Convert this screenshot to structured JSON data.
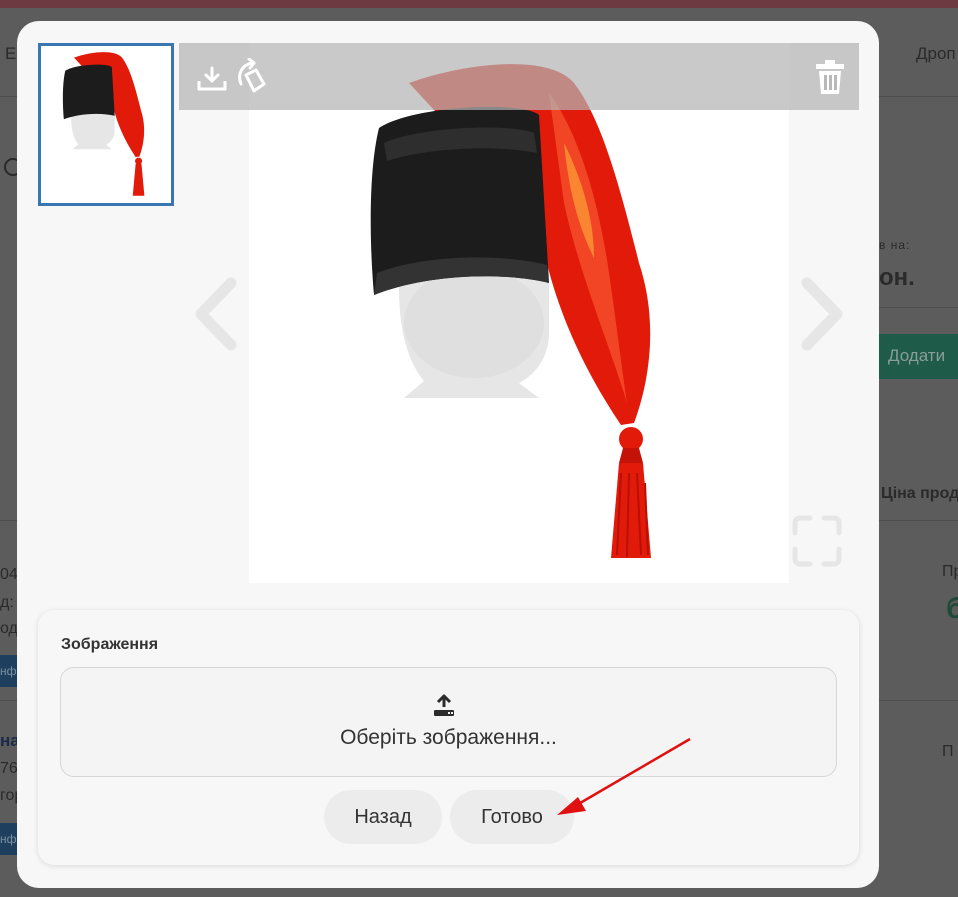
{
  "background": {
    "fragments": [
      "Е",
      "Дроп",
      "в на:",
      "он.",
      "Додати",
      "Ціна прод",
      "04",
      "д: Г",
      "одн",
      "нф",
      "на",
      "76",
      "гор",
      "нф",
      "Пр",
      "б",
      "П"
    ]
  },
  "viewer": {
    "toolbar": {
      "download_icon": "download-icon",
      "rotate_icon": "rotate-icon",
      "delete_icon": "trash-icon"
    },
    "prev_icon": "chevron-left-icon",
    "next_icon": "chevron-right-icon",
    "fullscreen_icon": "fullscreen-icon"
  },
  "panel": {
    "title": "Зображення",
    "upload_icon": "upload-icon",
    "upload_label": "Оберіть зображення...",
    "back_label": "Назад",
    "done_label": "Готово"
  },
  "colors": {
    "thumb_border": "#3a77b0",
    "annotation_arrow": "#e01010",
    "hat_red": "#e21a0a",
    "hat_black": "#1c1c1c"
  }
}
